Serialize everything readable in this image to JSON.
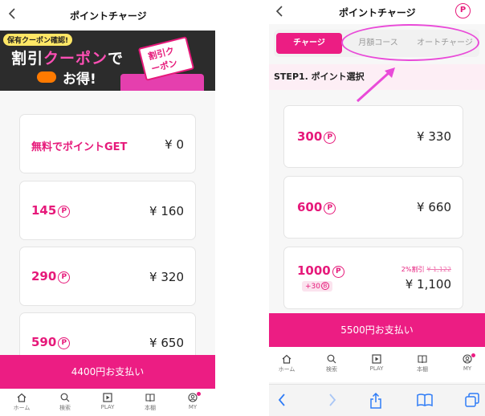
{
  "left": {
    "header": {
      "back_icon": "chevron-left-icon",
      "title": "ポイントチャージ"
    },
    "banner": {
      "tag": "保有クーポン確認!",
      "line1_a": "割引",
      "line1_b": "クーポン",
      "line1_c": "で",
      "line2": "お得!",
      "ticket": "割引クーポン"
    },
    "plans": [
      {
        "name": "無料でポイントGET",
        "price": "¥ 0",
        "has_icon": false
      },
      {
        "name": "145",
        "price": "¥ 160",
        "has_icon": true
      },
      {
        "name": "290",
        "price": "¥ 320",
        "has_icon": true
      },
      {
        "name": "590",
        "price": "¥ 650",
        "has_icon": true
      }
    ],
    "point_icon_label": "P",
    "pay_button": "4400円お支払い",
    "tabs": [
      {
        "label": "ホーム",
        "icon": "home-icon"
      },
      {
        "label": "検索",
        "icon": "search-icon"
      },
      {
        "label": "PLAY",
        "icon": "play-icon"
      },
      {
        "label": "本棚",
        "icon": "book-icon"
      },
      {
        "label": "MY",
        "icon": "user-icon"
      }
    ]
  },
  "right": {
    "header": {
      "back_icon": "chevron-left-icon",
      "title": "ポイントチャージ",
      "point_icon": "P"
    },
    "segments": [
      "チャージ",
      "月額コース",
      "オートチャージ"
    ],
    "active_segment": 0,
    "step_title": "STEP1. ポイント選択",
    "plans": [
      {
        "points": "300",
        "price": "¥ 330"
      },
      {
        "points": "600",
        "price": "¥ 660"
      },
      {
        "points": "1000",
        "price": "¥ 1,100",
        "discount": "2%割引",
        "old_price": "¥ 1,122",
        "bonus": "+30",
        "bonus_icon": "B"
      }
    ],
    "pay_button": "5500円お支払い",
    "tabs": [
      {
        "label": "ホーム",
        "icon": "home-icon"
      },
      {
        "label": "検索",
        "icon": "search-icon"
      },
      {
        "label": "PLAY",
        "icon": "play-icon"
      },
      {
        "label": "本棚",
        "icon": "book-icon"
      },
      {
        "label": "MY",
        "icon": "user-icon"
      }
    ],
    "browser_toolbar": [
      "back-arrow-icon",
      "forward-arrow-icon",
      "share-icon",
      "bookmarks-icon",
      "tabs-icon"
    ]
  },
  "colors": {
    "accent": "#ec1d83",
    "annotation": "#e94ad8"
  }
}
